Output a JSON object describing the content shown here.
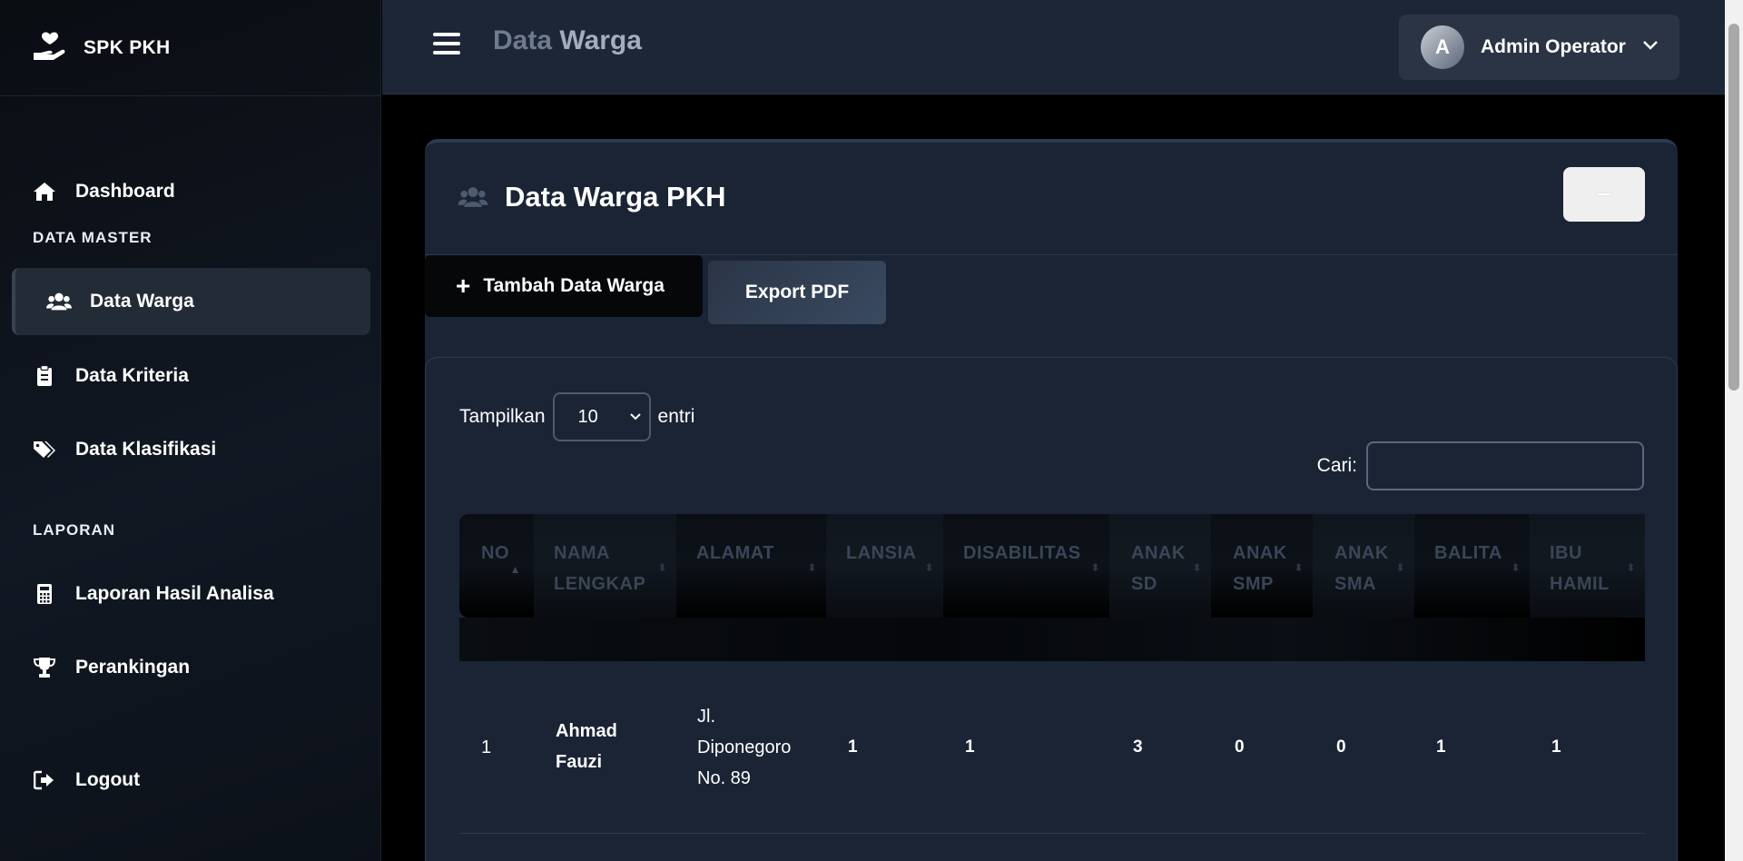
{
  "app": {
    "brand": "SPK PKH",
    "page_title_part1": "Data",
    "page_title_part2": "Warga"
  },
  "sidebar": {
    "items": [
      {
        "label": "Dashboard",
        "icon": "home-icon"
      },
      {
        "heading": "DATA MASTER"
      },
      {
        "label": "Data Warga",
        "icon": "users-icon",
        "active": true
      },
      {
        "label": "Data Kriteria",
        "icon": "clipboard-icon"
      },
      {
        "label": "Data Klasifikasi",
        "icon": "tags-icon"
      },
      {
        "heading": "LAPORAN"
      },
      {
        "label": "Laporan Hasil Analisa",
        "icon": "calculator-icon"
      },
      {
        "label": "Perankingan",
        "icon": "trophy-icon"
      },
      {
        "label": "Logout",
        "icon": "logout-icon"
      }
    ]
  },
  "user": {
    "initial": "A",
    "name": "Admin Operator"
  },
  "card": {
    "title": "Data Warga PKH",
    "add_label": "Tambah Data Warga",
    "export_label": "Export PDF"
  },
  "table_controls": {
    "show_label": "Tampilkan",
    "entries_value": "10",
    "entries_label": "entri",
    "search_label": "Cari:",
    "search_value": ""
  },
  "table": {
    "columns": [
      {
        "line1": "NO",
        "line2": ""
      },
      {
        "line1": "NAMA",
        "line2": "LENGKAP"
      },
      {
        "line1": "ALAMAT",
        "line2": ""
      },
      {
        "line1": "LANSIA",
        "line2": ""
      },
      {
        "line1": "DISABILITAS",
        "line2": ""
      },
      {
        "line1": "ANAK",
        "line2": "SD"
      },
      {
        "line1": "ANAK",
        "line2": "SMP"
      },
      {
        "line1": "ANAK",
        "line2": "SMA"
      },
      {
        "line1": "BALITA",
        "line2": ""
      },
      {
        "line1": "IBU",
        "line2": "HAMIL"
      }
    ],
    "rows": [
      {
        "no": "1",
        "nama_line1": "Ahmad",
        "nama_line2": "Fauzi",
        "alamat_line1": "Jl.",
        "alamat_line2": "Diponegoro",
        "alamat_line3": "No. 89",
        "lansia": "1",
        "disabilitas": "1",
        "anak_sd": "3",
        "anak_smp": "0",
        "anak_sma": "0",
        "balita": "1",
        "ibu_hamil": "1"
      }
    ]
  }
}
